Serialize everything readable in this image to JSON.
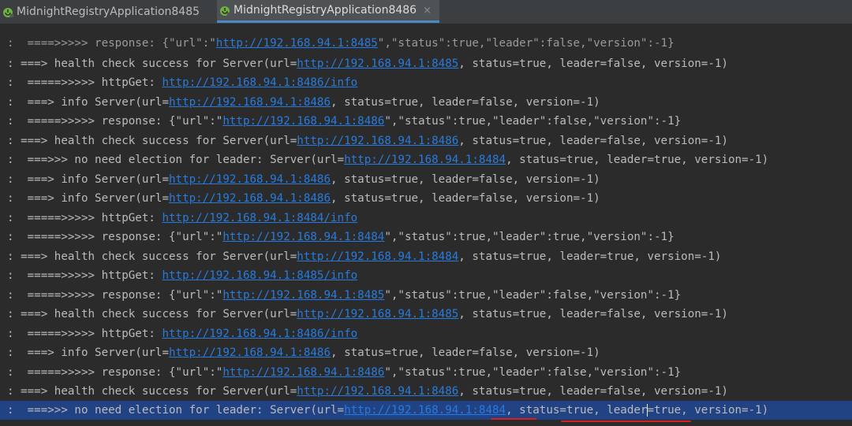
{
  "tabs": [
    {
      "label": "MidnightRegistryApplication8485",
      "active": false,
      "icon": "spring-boot-icon"
    },
    {
      "label": "MidnightRegistryApplication8486",
      "active": true,
      "icon": "spring-boot-icon",
      "close": "×"
    }
  ],
  "console": {
    "lines": [
      {
        "pre": ":  ====>>>>> response: {\"url\":\"",
        "link": "http://192.168.94.1:8485",
        "post": "\",\"status\":true,\"leader\":false,\"version\":-1}"
      },
      {
        "pre": ": ===> health check success for Server(url=",
        "link": "http://192.168.94.1:8485",
        "post": ", status=true, leader=false, version=-1)"
      },
      {
        "pre": ":  =====>>>>> httpGet: ",
        "link": "http://192.168.94.1:8486/info",
        "post": ""
      },
      {
        "pre": ":  ===> info Server(url=",
        "link": "http://192.168.94.1:8486",
        "post": ", status=true, leader=false, version=-1)"
      },
      {
        "pre": ":  =====>>>>> response: {\"url\":\"",
        "link": "http://192.168.94.1:8486",
        "post": "\",\"status\":true,\"leader\":false,\"version\":-1}"
      },
      {
        "pre": ": ===> health check success for Server(url=",
        "link": "http://192.168.94.1:8486",
        "post": ", status=true, leader=false, version=-1)"
      },
      {
        "pre": ":  ===>>> no need election for leader: Server(url=",
        "link": "http://192.168.94.1:8484",
        "post": ", status=true, leader=true, version=-1)"
      },
      {
        "pre": ":  ===> info Server(url=",
        "link": "http://192.168.94.1:8486",
        "post": ", status=true, leader=false, version=-1)"
      },
      {
        "pre": ":  ===> info Server(url=",
        "link": "http://192.168.94.1:8486",
        "post": ", status=true, leader=false, version=-1)"
      },
      {
        "pre": ":  =====>>>>> httpGet: ",
        "link": "http://192.168.94.1:8484/info",
        "post": ""
      },
      {
        "pre": ":  =====>>>>> response: {\"url\":\"",
        "link": "http://192.168.94.1:8484",
        "post": "\",\"status\":true,\"leader\":true,\"version\":-1}"
      },
      {
        "pre": ": ===> health check success for Server(url=",
        "link": "http://192.168.94.1:8484",
        "post": ", status=true, leader=true, version=-1)"
      },
      {
        "pre": ":  =====>>>>> httpGet: ",
        "link": "http://192.168.94.1:8485/info",
        "post": ""
      },
      {
        "pre": ":  =====>>>>> response: {\"url\":\"",
        "link": "http://192.168.94.1:8485",
        "post": "\",\"status\":true,\"leader\":false,\"version\":-1}"
      },
      {
        "pre": ": ===> health check success for Server(url=",
        "link": "http://192.168.94.1:8485",
        "post": ", status=true, leader=false, version=-1)"
      },
      {
        "pre": ":  =====>>>>> httpGet: ",
        "link": "http://192.168.94.1:8486/info",
        "post": ""
      },
      {
        "pre": ":  ===> info Server(url=",
        "link": "http://192.168.94.1:8486",
        "post": ", status=true, leader=false, version=-1)"
      },
      {
        "pre": ":  =====>>>>> response: {\"url\":\"",
        "link": "http://192.168.94.1:8486",
        "post": "\",\"status\":true,\"leader\":false,\"version\":-1}"
      },
      {
        "pre": ": ===> health check success for Server(url=",
        "link": "http://192.168.94.1:8486",
        "post": ", status=true, leader=false, version=-1)"
      },
      {
        "pre": ":  ===>>> no need election for leader: Server(url=",
        "link": "http://192.168.94.1:8484",
        "post": ", status=true, leader=true, version=-1)"
      }
    ]
  },
  "colors": {
    "background": "#2b2b2b",
    "text": "#bbbbbb",
    "link": "#287bde",
    "selection": "#214283",
    "annotation": "#d42020"
  }
}
